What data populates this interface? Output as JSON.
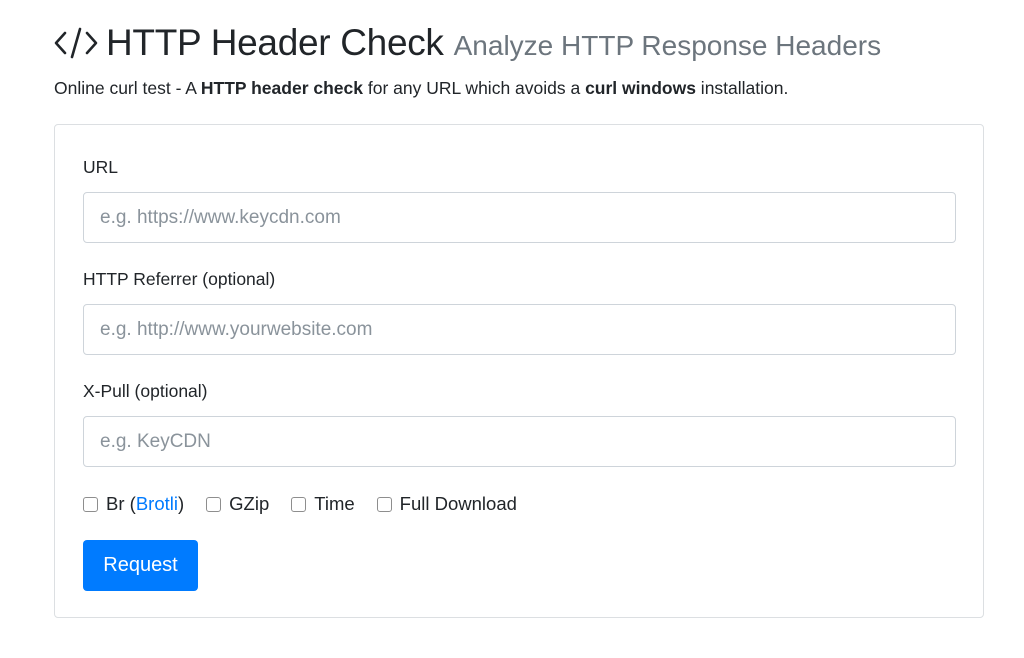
{
  "header": {
    "title": "HTTP Header Check",
    "subtitle": "Analyze HTTP Response Headers",
    "icon": "code-icon"
  },
  "intro": {
    "part1": "Online curl test - A ",
    "bold1": "HTTP header check",
    "part2": " for any URL which avoids a ",
    "bold2": "curl windows",
    "part3": " installation."
  },
  "form": {
    "url_label": "URL",
    "url_placeholder": "e.g. https://www.keycdn.com",
    "referrer_label": "HTTP Referrer (optional)",
    "referrer_placeholder": "e.g. http://www.yourwebsite.com",
    "xpull_label": "X-Pull (optional)",
    "xpull_placeholder": "e.g. KeyCDN",
    "options": {
      "br_prefix": "Br (",
      "br_link": "Brotli",
      "br_suffix": ")",
      "gzip": "GZip",
      "time": "Time",
      "full_download": "Full Download"
    },
    "submit_label": "Request"
  },
  "colors": {
    "primary": "#007bff",
    "muted": "#6c757d",
    "text": "#212529"
  }
}
